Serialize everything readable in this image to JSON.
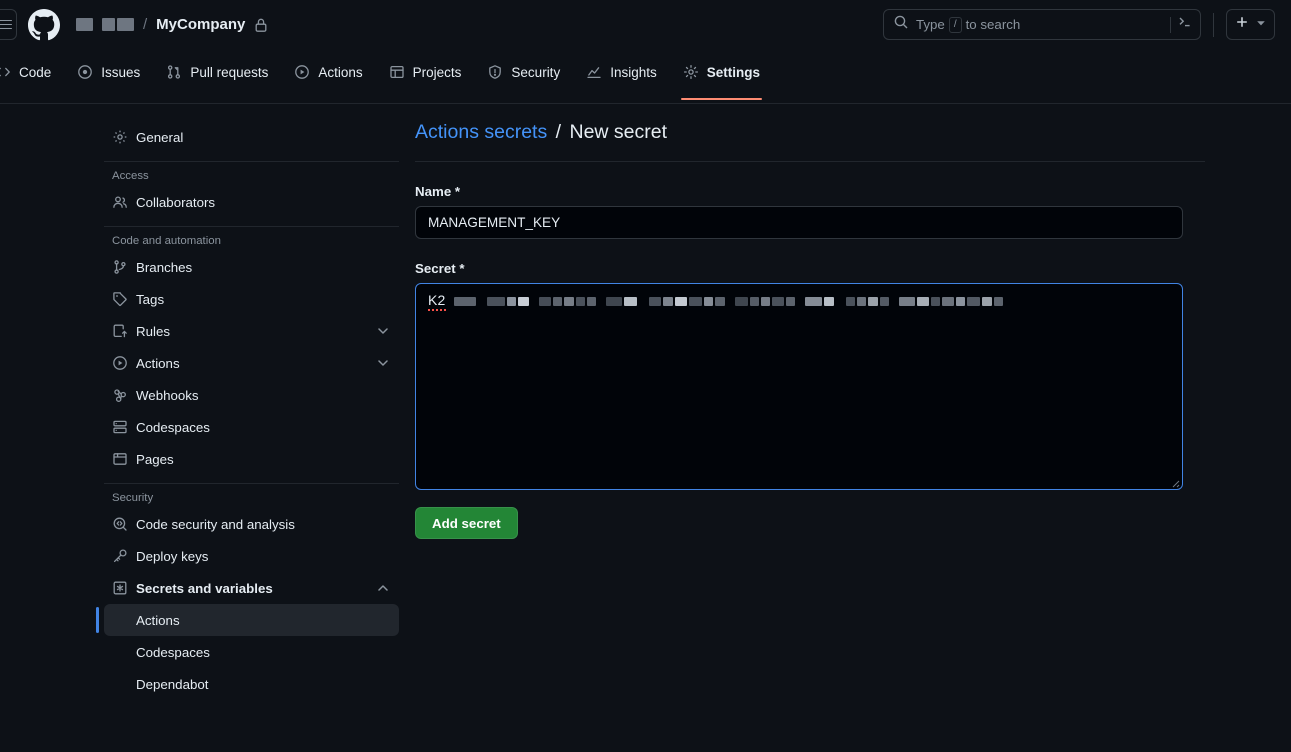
{
  "header": {
    "hamburger_icon": "hamburger-menu-icon",
    "logo_icon": "github-logo-icon",
    "owner_redacted": true,
    "repo_name": "MyCompany",
    "lock_icon": "lock-icon",
    "search": {
      "icon": "search-icon",
      "placeholder_prefix": "Type",
      "placeholder_key": "/",
      "placeholder_suffix": "to search",
      "command_icon": "terminal-icon"
    },
    "create": {
      "plus_icon": "plus-icon",
      "chevron_icon": "chevron-down-icon"
    }
  },
  "repo_nav": {
    "tabs": [
      {
        "label": "Code",
        "icon": "code-icon",
        "active": false
      },
      {
        "label": "Issues",
        "icon": "issue-opened-icon",
        "active": false
      },
      {
        "label": "Pull requests",
        "icon": "git-pull-request-icon",
        "active": false
      },
      {
        "label": "Actions",
        "icon": "play-icon",
        "active": false
      },
      {
        "label": "Projects",
        "icon": "table-icon",
        "active": false
      },
      {
        "label": "Security",
        "icon": "shield-icon",
        "active": false
      },
      {
        "label": "Insights",
        "icon": "graph-icon",
        "active": false
      },
      {
        "label": "Settings",
        "icon": "gear-icon",
        "active": true
      }
    ],
    "active_underline_color": "#fd8c73"
  },
  "sidebar": {
    "general": {
      "label": "General",
      "icon": "gear-icon"
    },
    "sections": [
      {
        "heading": "Access",
        "items": [
          {
            "label": "Collaborators",
            "icon": "people-icon"
          }
        ]
      },
      {
        "heading": "Code and automation",
        "items": [
          {
            "label": "Branches",
            "icon": "git-branch-icon"
          },
          {
            "label": "Tags",
            "icon": "tag-icon"
          },
          {
            "label": "Rules",
            "icon": "rules-icon",
            "chevron": "chevron-down-icon"
          },
          {
            "label": "Actions",
            "icon": "play-icon",
            "chevron": "chevron-down-icon"
          },
          {
            "label": "Webhooks",
            "icon": "webhook-icon"
          },
          {
            "label": "Codespaces",
            "icon": "codespaces-icon"
          },
          {
            "label": "Pages",
            "icon": "browser-icon"
          }
        ]
      },
      {
        "heading": "Security",
        "items": [
          {
            "label": "Code security and analysis",
            "icon": "codescan-icon"
          },
          {
            "label": "Deploy keys",
            "icon": "key-icon"
          },
          {
            "label": "Secrets and variables",
            "icon": "asterisk-icon",
            "chevron": "chevron-up-icon",
            "bold": true
          }
        ]
      }
    ],
    "sub_items": [
      {
        "label": "Actions",
        "selected": true
      },
      {
        "label": "Codespaces",
        "selected": false
      },
      {
        "label": "Dependabot",
        "selected": false
      }
    ],
    "selected_accent_color": "#4184e4"
  },
  "main": {
    "breadcrumb": {
      "link": "Actions secrets",
      "separator": "/",
      "current": "New secret"
    },
    "name_field": {
      "label": "Name",
      "required_marker": "*",
      "value": "MANAGEMENT_KEY"
    },
    "secret_field": {
      "label": "Secret",
      "required_marker": "*",
      "value_visible": "K2",
      "redacted": true,
      "focused": true
    },
    "submit_button": {
      "label": "Add secret",
      "color": "#238636"
    }
  }
}
